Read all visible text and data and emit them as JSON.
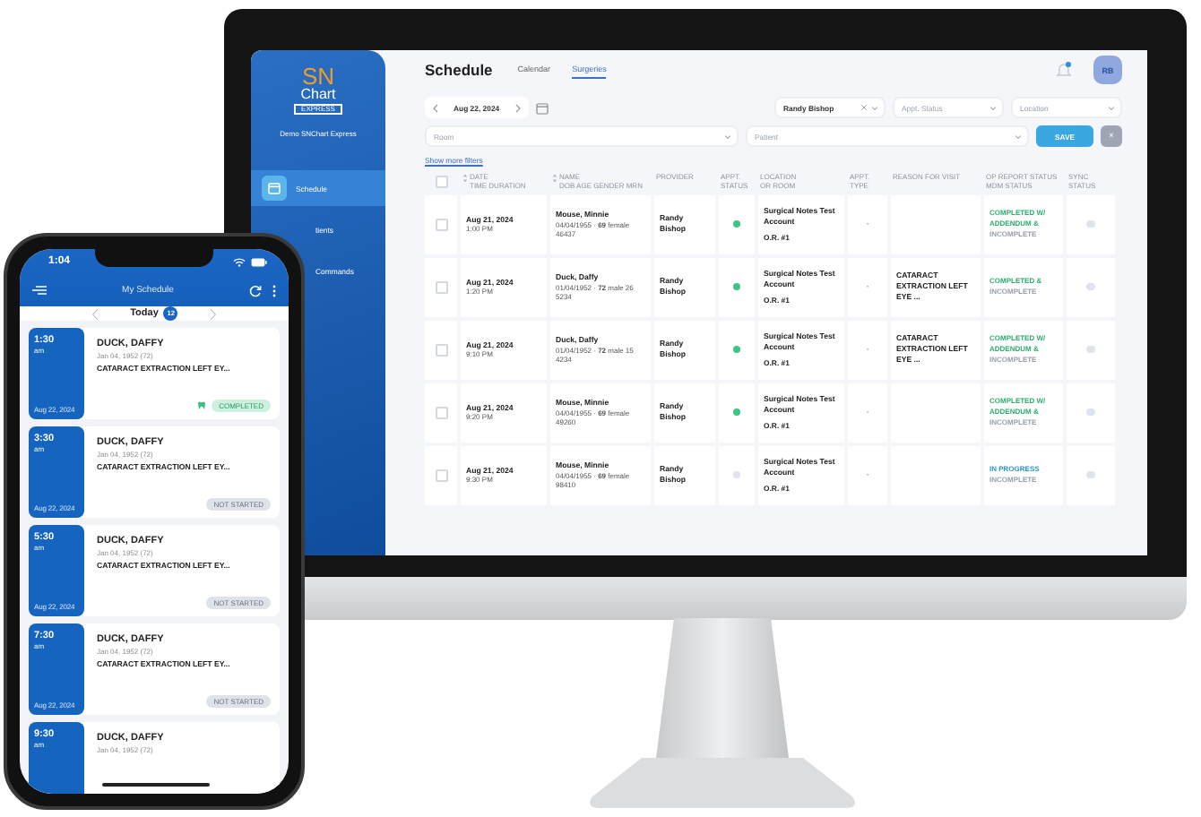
{
  "monitor": {
    "sidebar": {
      "logo": {
        "primary": "SN",
        "secondary": "Chart",
        "tagline": "EXPRESS"
      },
      "account": "Demo SNChart Express",
      "items": [
        {
          "label": "Schedule",
          "selected": true
        },
        {
          "label": "tients",
          "selected": false
        },
        {
          "label": "Commands",
          "selected": false
        }
      ]
    },
    "header": {
      "title": "Schedule",
      "tabs": [
        {
          "label": "Calendar",
          "selected": false
        },
        {
          "label": "Surgeries",
          "selected": true
        }
      ],
      "notifications": {
        "unread": true
      },
      "avatar": "RB"
    },
    "date_nav": {
      "date": "Aug 22, 2024"
    },
    "filters": {
      "provider": {
        "value": "Randy Bishop"
      },
      "appt_status": {
        "placeholder": "Appt. Status"
      },
      "location": {
        "placeholder": "Location"
      },
      "room": {
        "placeholder": "Room"
      },
      "patient": {
        "placeholder": "Patient"
      }
    },
    "save_button": "SAVE",
    "clear_button": "×",
    "show_more_filters": "Show more filters",
    "table": {
      "select_all": {
        "checked": false
      },
      "columns": [
        {
          "label": "DATE",
          "sublabel": "TIME DURATION",
          "sortable": true
        },
        {
          "label": "NAME",
          "sublabel": "DOB AGE GENDER MRN",
          "sortable": true
        },
        {
          "label": "PROVIDER",
          "sortable": false
        },
        {
          "label": "APPT. STATUS",
          "sortable": false
        },
        {
          "label": "LOCATION",
          "sublabel": "OR ROOM",
          "sortable": false
        },
        {
          "label": "APPT. TYPE",
          "sortable": false
        },
        {
          "label": "REASON FOR VISIT",
          "sortable": false
        },
        {
          "label": "OP REPORT STATUS",
          "sublabel": "MDM STATUS",
          "sortable": false
        },
        {
          "label": "SYNC STATUS",
          "sortable": false
        }
      ],
      "rows": [
        {
          "checked": false,
          "date": "Aug 21, 2024",
          "time": "1:00 PM",
          "name": "Mouse, Minnie",
          "details": "04/04/1955 · **69** female 46437",
          "provider": "Randy Bishop",
          "status_dot": {
            "color": "#3cc585"
          },
          "location": "Surgical Notes Test Account",
          "room": "O.R. #1",
          "appt_type": "-",
          "op_status": [
            {
              "text": "COMPLETED W/",
              "kind": "done"
            },
            {
              "text": "ADDENDUM &",
              "kind": "done"
            },
            {
              "text": "INCOMPLETE",
              "kind": "incomplete"
            }
          ]
        },
        {
          "checked": false,
          "date": "Aug 21, 2024",
          "time": "1:20 PM",
          "name": "Duck, Daffy",
          "details": "01/04/1952 · **72** male 26 5234",
          "provider": "Randy Bishop",
          "status_dot": {
            "color": "#3cc585"
          },
          "location": "Surgical Notes Test Account",
          "room": "O.R. #1",
          "appt_type": "-",
          "reason": "CATARACT EXTRACTION LEFT EYE ...",
          "op_status": [
            {
              "text": "COMPLETED &",
              "kind": "done"
            },
            {
              "text": "INCOMPLETE",
              "kind": "incomplete"
            }
          ]
        },
        {
          "checked": false,
          "date": "Aug 21, 2024",
          "time": "9:10 PM",
          "name": "Duck, Daffy",
          "details": "01/04/1952 · **72** male 15 4234",
          "provider": "Randy Bishop",
          "status_dot": {
            "color": "#3cc585"
          },
          "location": "Surgical Notes Test Account",
          "room": "O.R. #1",
          "appt_type": "-",
          "reason": "CATARACT EXTRACTION LEFT EYE ...",
          "op_status": [
            {
              "text": "COMPLETED W/",
              "kind": "done"
            },
            {
              "text": "ADDENDUM &",
              "kind": "done"
            },
            {
              "text": "INCOMPLETE",
              "kind": "incomplete"
            }
          ]
        },
        {
          "checked": false,
          "date": "Aug 21, 2024",
          "time": "9:20 PM",
          "name": "Mouse, Minnie",
          "details": "04/04/1955 · **69** female 49260",
          "provider": "Randy Bishop",
          "status_dot": {
            "color": "#3cc585"
          },
          "location": "Surgical Notes Test Account",
          "room": "O.R. #1",
          "appt_type": "-",
          "op_status": [
            {
              "text": "COMPLETED W/",
              "kind": "done"
            },
            {
              "text": "ADDENDUM &",
              "kind": "done"
            },
            {
              "text": "INCOMPLETE",
              "kind": "incomplete"
            }
          ]
        },
        {
          "checked": false,
          "date": "Aug 21, 2024",
          "time": "9:30 PM",
          "name": "Mouse, Minnie",
          "details": "04/04/1955 · **69** female 98410",
          "provider": "Randy Bishop",
          "status_dot": {
            "color": "#dfe3ee"
          },
          "location": "Surgical Notes Test Account",
          "room": "O.R. #1",
          "appt_type": "-",
          "op_status": [
            {
              "text": "IN PROGRESS",
              "kind": "progress"
            },
            {
              "text": "INCOMPLETE",
              "kind": "incomplete"
            }
          ]
        }
      ]
    }
  },
  "phone": {
    "status_bar": {
      "time": "1:04"
    },
    "header": {
      "title": "My Schedule"
    },
    "day": {
      "label": "Today",
      "count": "12"
    },
    "appointments": [
      {
        "time": "1:30",
        "period": "am",
        "date": "Aug 22, 2024",
        "name": "DUCK, DAFFY",
        "dob": "Jan 04, 1952 (72)",
        "procedure": "CATARACT EXTRACTION LEFT EY...",
        "status": {
          "text": "COMPLETED",
          "kind": "completed"
        }
      },
      {
        "time": "3:30",
        "period": "am",
        "date": "Aug 22, 2024",
        "name": "DUCK, DAFFY",
        "dob": "Jan 04, 1952 (72)",
        "procedure": "CATARACT EXTRACTION LEFT EY...",
        "status": {
          "text": "NOT STARTED",
          "kind": "not_started"
        }
      },
      {
        "time": "5:30",
        "period": "am",
        "date": "Aug 22, 2024",
        "name": "DUCK, DAFFY",
        "dob": "Jan 04, 1952 (72)",
        "procedure": "CATARACT EXTRACTION LEFT EY...",
        "status": {
          "text": "NOT STARTED",
          "kind": "not_started"
        }
      },
      {
        "time": "7:30",
        "period": "am",
        "date": "Aug 22, 2024",
        "name": "DUCK, DAFFY",
        "dob": "Jan 04, 1952 (72)",
        "procedure": "CATARACT EXTRACTION LEFT EY...",
        "status": {
          "text": "NOT STARTED",
          "kind": "not_started"
        }
      },
      {
        "time": "9:30",
        "period": "am",
        "name": "DUCK, DAFFY",
        "dob": "Jan 04, 1952 (72)"
      }
    ]
  }
}
